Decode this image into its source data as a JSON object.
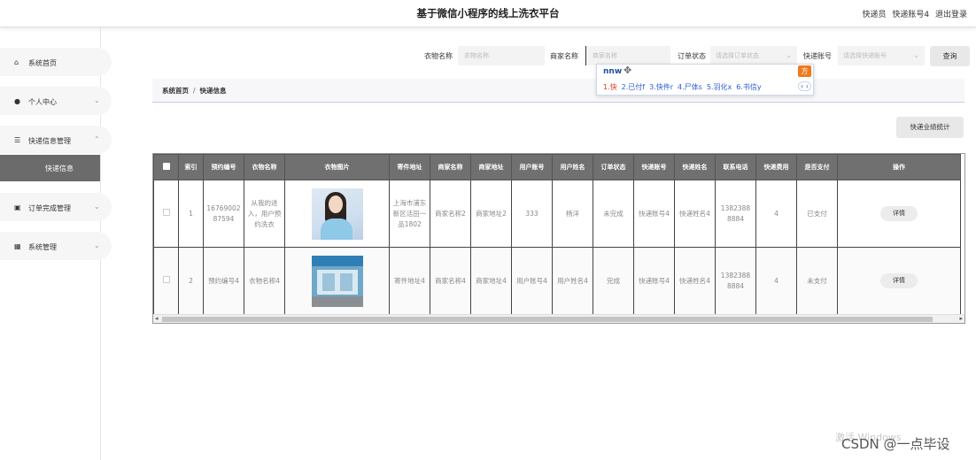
{
  "header": {
    "title": "基于微信小程序的线上洗衣平台",
    "role": "快递员",
    "account": "快递账号4",
    "logout": "退出登录"
  },
  "sidebar": {
    "items": [
      {
        "icon": "home-icon",
        "label": "系统首页"
      },
      {
        "icon": "user-icon",
        "label": "个人中心"
      },
      {
        "icon": "list-icon",
        "label": "快递信息管理"
      },
      {
        "icon": "order-icon",
        "label": "订单完成管理"
      },
      {
        "icon": "grid-icon",
        "label": "系统管理"
      }
    ],
    "active_sub": "快递信息"
  },
  "filters": {
    "clothes_name": {
      "label": "衣物名称",
      "placeholder": "衣物名称"
    },
    "merchant_name": {
      "label": "商家名称",
      "placeholder": "商家名称"
    },
    "order_status": {
      "label": "订单状态",
      "placeholder": "请选择订单状态"
    },
    "courier_account": {
      "label": "快递账号",
      "placeholder": "请选择快递账号"
    },
    "query_label": "查询"
  },
  "ime": {
    "typed": "nnw",
    "candidates": [
      "1.快",
      "2.已付f",
      "3.快件r",
      "4.尸体s",
      "5.羽化x",
      "6.书信y"
    ],
    "pager": "‹ ›"
  },
  "breadcrumb": {
    "home": "系统首页",
    "separator": "/",
    "current": "快递信息"
  },
  "stats_button": "快递业绩统计",
  "table": {
    "headers": [
      "索引",
      "预约编号",
      "衣物名称",
      "衣物图片",
      "寄件地址",
      "商家名称",
      "商家地址",
      "用户账号",
      "用户姓名",
      "订单状态",
      "快递账号",
      "快递姓名",
      "联系电话",
      "快递费用",
      "是否支付",
      "操作"
    ],
    "rows": [
      {
        "index": "1",
        "booking_no": "1676900287594",
        "clothes": "从我的进入，用户预约洗衣",
        "image": "woman-photo",
        "address": "上海市浦东新区活田一品1802",
        "merchant": "商家名称2",
        "merchant_addr": "商家地址2",
        "user_account": "333",
        "user_name": "杨洋",
        "status": "未完成",
        "courier_account": "快递账号4",
        "courier_name": "快递姓名4",
        "phone": "13823888884",
        "fee": "4",
        "paid": "已支付",
        "action": "详情"
      },
      {
        "index": "2",
        "booking_no": "预约编号4",
        "clothes": "衣物名称4",
        "image": "shop-photo",
        "address": "寄件地址4",
        "merchant": "商家名称4",
        "merchant_addr": "商家地址4",
        "user_account": "用户账号4",
        "user_name": "用户姓名4",
        "status": "完成",
        "courier_account": "快递账号4",
        "courier_name": "快递姓名4",
        "phone": "13823888884",
        "fee": "4",
        "paid": "未支付",
        "action": "详情"
      }
    ]
  },
  "watermark": {
    "activate": "激活 Windows",
    "credit": "CSDN @一点毕设"
  }
}
